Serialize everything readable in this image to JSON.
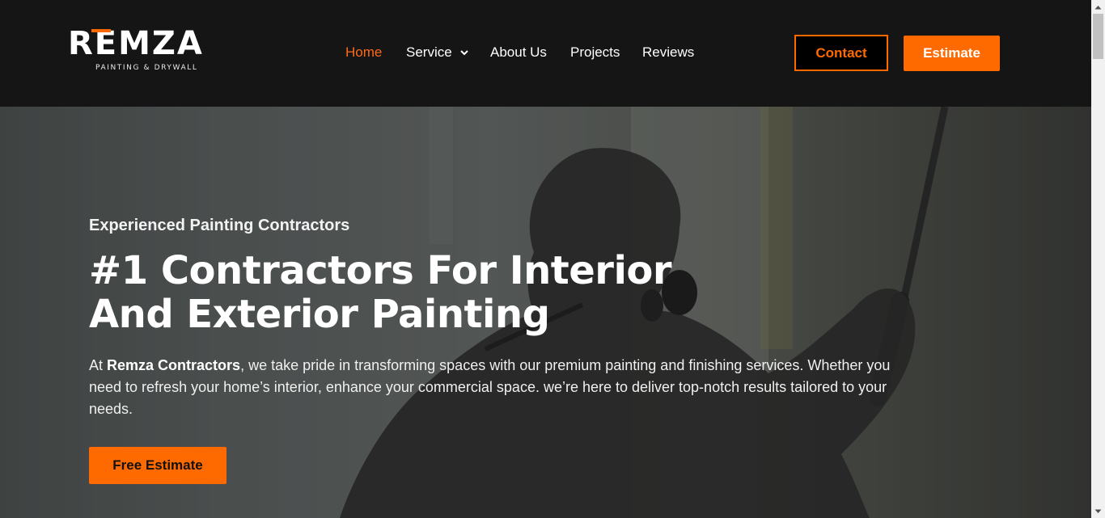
{
  "brand": {
    "name": "REMZA",
    "tagline": "PAINTING & DRYWALL",
    "accent_color": "#ff6a00"
  },
  "nav": {
    "items": [
      {
        "label": "Home",
        "active": true
      },
      {
        "label": "Service",
        "has_dropdown": true
      },
      {
        "label": "About Us"
      },
      {
        "label": "Projects"
      },
      {
        "label": "Reviews"
      }
    ],
    "active_color": "#ff6a1a"
  },
  "header_buttons": {
    "contact_label": "Contact",
    "estimate_label": "Estimate"
  },
  "hero": {
    "eyebrow": "Experienced Painting Contractors",
    "headline": "#1 Contractors For Interior And Exterior Painting",
    "desc_prefix": "At ",
    "desc_bold": "Remza Contractors",
    "desc_rest": ", we take pride in transforming spaces with our premium painting and finishing services. Whether you need to refresh your home’s interior, enhance your commercial space. we’re here to deliver top-notch results tailored to your needs.",
    "cta_label": "Free Estimate"
  },
  "icons": {
    "dropdown": "chevron-down-icon",
    "scroll_up": "scroll-up-arrow-icon",
    "scroll_down": "scroll-down-arrow-icon"
  }
}
